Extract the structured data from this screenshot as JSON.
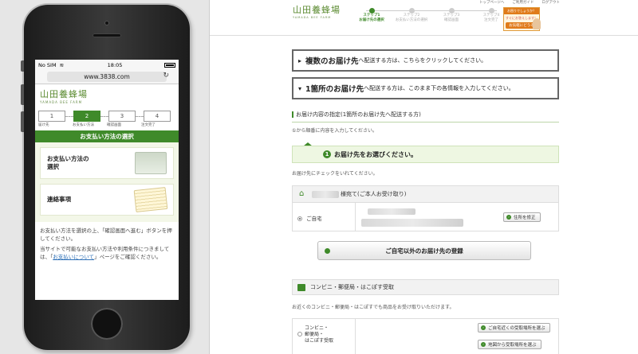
{
  "phone": {
    "status": {
      "carrier": "No SIM",
      "wifi": "wifi",
      "time": "18:05"
    },
    "url": "www.3838.com",
    "logo_jp": "山田養蜂場",
    "logo_en": "YAMADA BEE FARM",
    "steps": [
      {
        "num": "1",
        "label": "届け先"
      },
      {
        "num": "2",
        "label": "お支払い方法"
      },
      {
        "num": "3",
        "label": "確認画面"
      },
      {
        "num": "4",
        "label": "注文完了"
      }
    ],
    "title": "お支払い方法の選択",
    "card_payment": "お支払い方法の\n選択",
    "card_contact": "連絡事項",
    "text1": "お支払い方法を選択の上、「確認画面へ進む」ボタンを押してください。",
    "text2_a": "当サイトで可能なお支払い方法や利用条件につきましては、「",
    "text2_link": "お支払いについて",
    "text2_b": "」ページをご確認ください。"
  },
  "desktop": {
    "logo_jp": "山田養蜂場",
    "logo_en": "YAMADA BEE FARM",
    "top_links": [
      "トップページへ",
      "ご利用ガイド",
      "ログアウト"
    ],
    "steps": [
      {
        "title": "ステップ1",
        "label": "お届け先の選択"
      },
      {
        "title": "ステップ2",
        "label": "お支払い方法の選択"
      },
      {
        "title": "ステップ3",
        "label": "確認画面"
      },
      {
        "title": "ステップ4",
        "label": "注文完了"
      }
    ],
    "banner_top": "お困りでしょうか？",
    "banner_mid": "すぐにお答えします！",
    "banner_btn": "お気軽にどうぞ",
    "multi_btn_bold": "複数のお届け先",
    "multi_btn_rest": "へ配送する方は、こちらをクリックしてください。",
    "single_btn_bold": "1箇所のお届け先",
    "single_btn_rest": "へ配送する方は、このまま下の各情報を入力してください。",
    "section_title": "お届け内容の指定(1箇所のお届け先へ配送する方)",
    "section_note": "①から順番に内容を入力してください。",
    "select_num": "1",
    "select_label": "お届け先をお選びください。",
    "check_note": "お届け先にチェックをいれてください。",
    "addr_head_suffix": "様宛て(ご本人お受け取り)",
    "home_label": "ご自宅",
    "edit_btn": "住所を修正",
    "register_btn": "ご自宅以外のお届け先の登録",
    "cvs_head": "コンビニ・郵便局・はこぽす受取",
    "cvs_note": "お近くのコンビニ・郵便局・はこぽすでも商品をお受け取りいただけます。",
    "cvs_label": "コンビニ・\n郵便局・\nはこぽす受取",
    "cvs_btn1": "ご自宅近くの受取場所を選ぶ",
    "cvs_btn2": "地図から受取場所を選ぶ"
  }
}
